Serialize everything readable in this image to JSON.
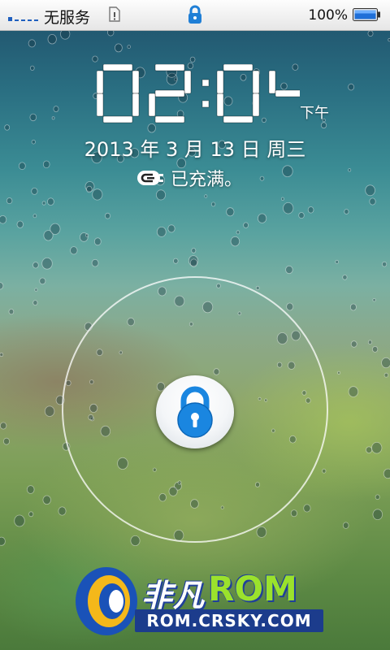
{
  "status_bar": {
    "carrier": "无服务",
    "battery_percent": "100%",
    "battery_level": 1.0,
    "icons": [
      "signal-bars-icon",
      "sim-alert-icon",
      "lock-icon",
      "battery-icon"
    ]
  },
  "clock": {
    "time": "02:04",
    "ampm": "下午"
  },
  "date": {
    "text": "2013 年 3 月 13 日 周三"
  },
  "charging": {
    "icon": "plug-icon",
    "text": "已充满。"
  },
  "unlock": {
    "icon": "padlock-icon"
  },
  "watermark": {
    "brand_cn": "非凡",
    "brand_rom": "ROM",
    "url": "ROM.CRSKY.COM"
  },
  "colors": {
    "accent_blue": "#1f8ae0",
    "status_bar_bg": "#f2f2f2",
    "text_white": "#ffffff"
  }
}
